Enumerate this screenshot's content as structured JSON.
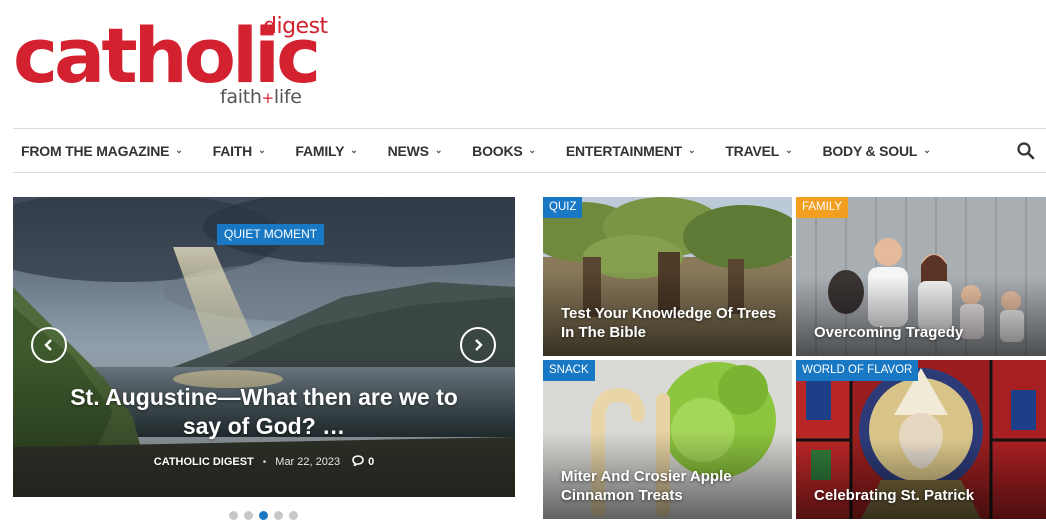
{
  "logo": {
    "main": "catholic",
    "digest": "digest",
    "tag_left": "faith",
    "tag_plus": "+",
    "tag_right": "life"
  },
  "nav": {
    "items": [
      {
        "label": "FROM THE MAGAZINE"
      },
      {
        "label": "FAITH"
      },
      {
        "label": "FAMILY"
      },
      {
        "label": "NEWS"
      },
      {
        "label": "BOOKS"
      },
      {
        "label": "ENTERTAINMENT"
      },
      {
        "label": "TRAVEL"
      },
      {
        "label": "BODY & SOUL"
      }
    ],
    "chevron": "⌄"
  },
  "slider": {
    "badge": "QUIET MOMENT",
    "title": "St. Augustine—What then are we to say of God? …",
    "author": "CATHOLIC DIGEST",
    "separator": "•",
    "date": "Mar 22, 2023",
    "comments": "0",
    "slide_count": 5,
    "active_slide": 3
  },
  "cards": [
    {
      "badge": "QUIZ",
      "title": "Test Your Knowledge Of Trees In The Bible",
      "badge_color": "#1878c4"
    },
    {
      "badge": "FAMILY",
      "title": "Overcoming Tragedy",
      "badge_color": "#f29f21"
    },
    {
      "badge": "SNACK",
      "title": "Miter And Crosier Apple Cinnamon Treats",
      "badge_color": "#1878c4"
    },
    {
      "badge": "WORLD OF FLAVOR",
      "title": "Celebrating St. Patrick",
      "badge_color": "#1878c4"
    }
  ],
  "colors": {
    "brand_red": "#d3212f",
    "accent_blue": "#1878c4",
    "family_orange": "#f29f21"
  }
}
